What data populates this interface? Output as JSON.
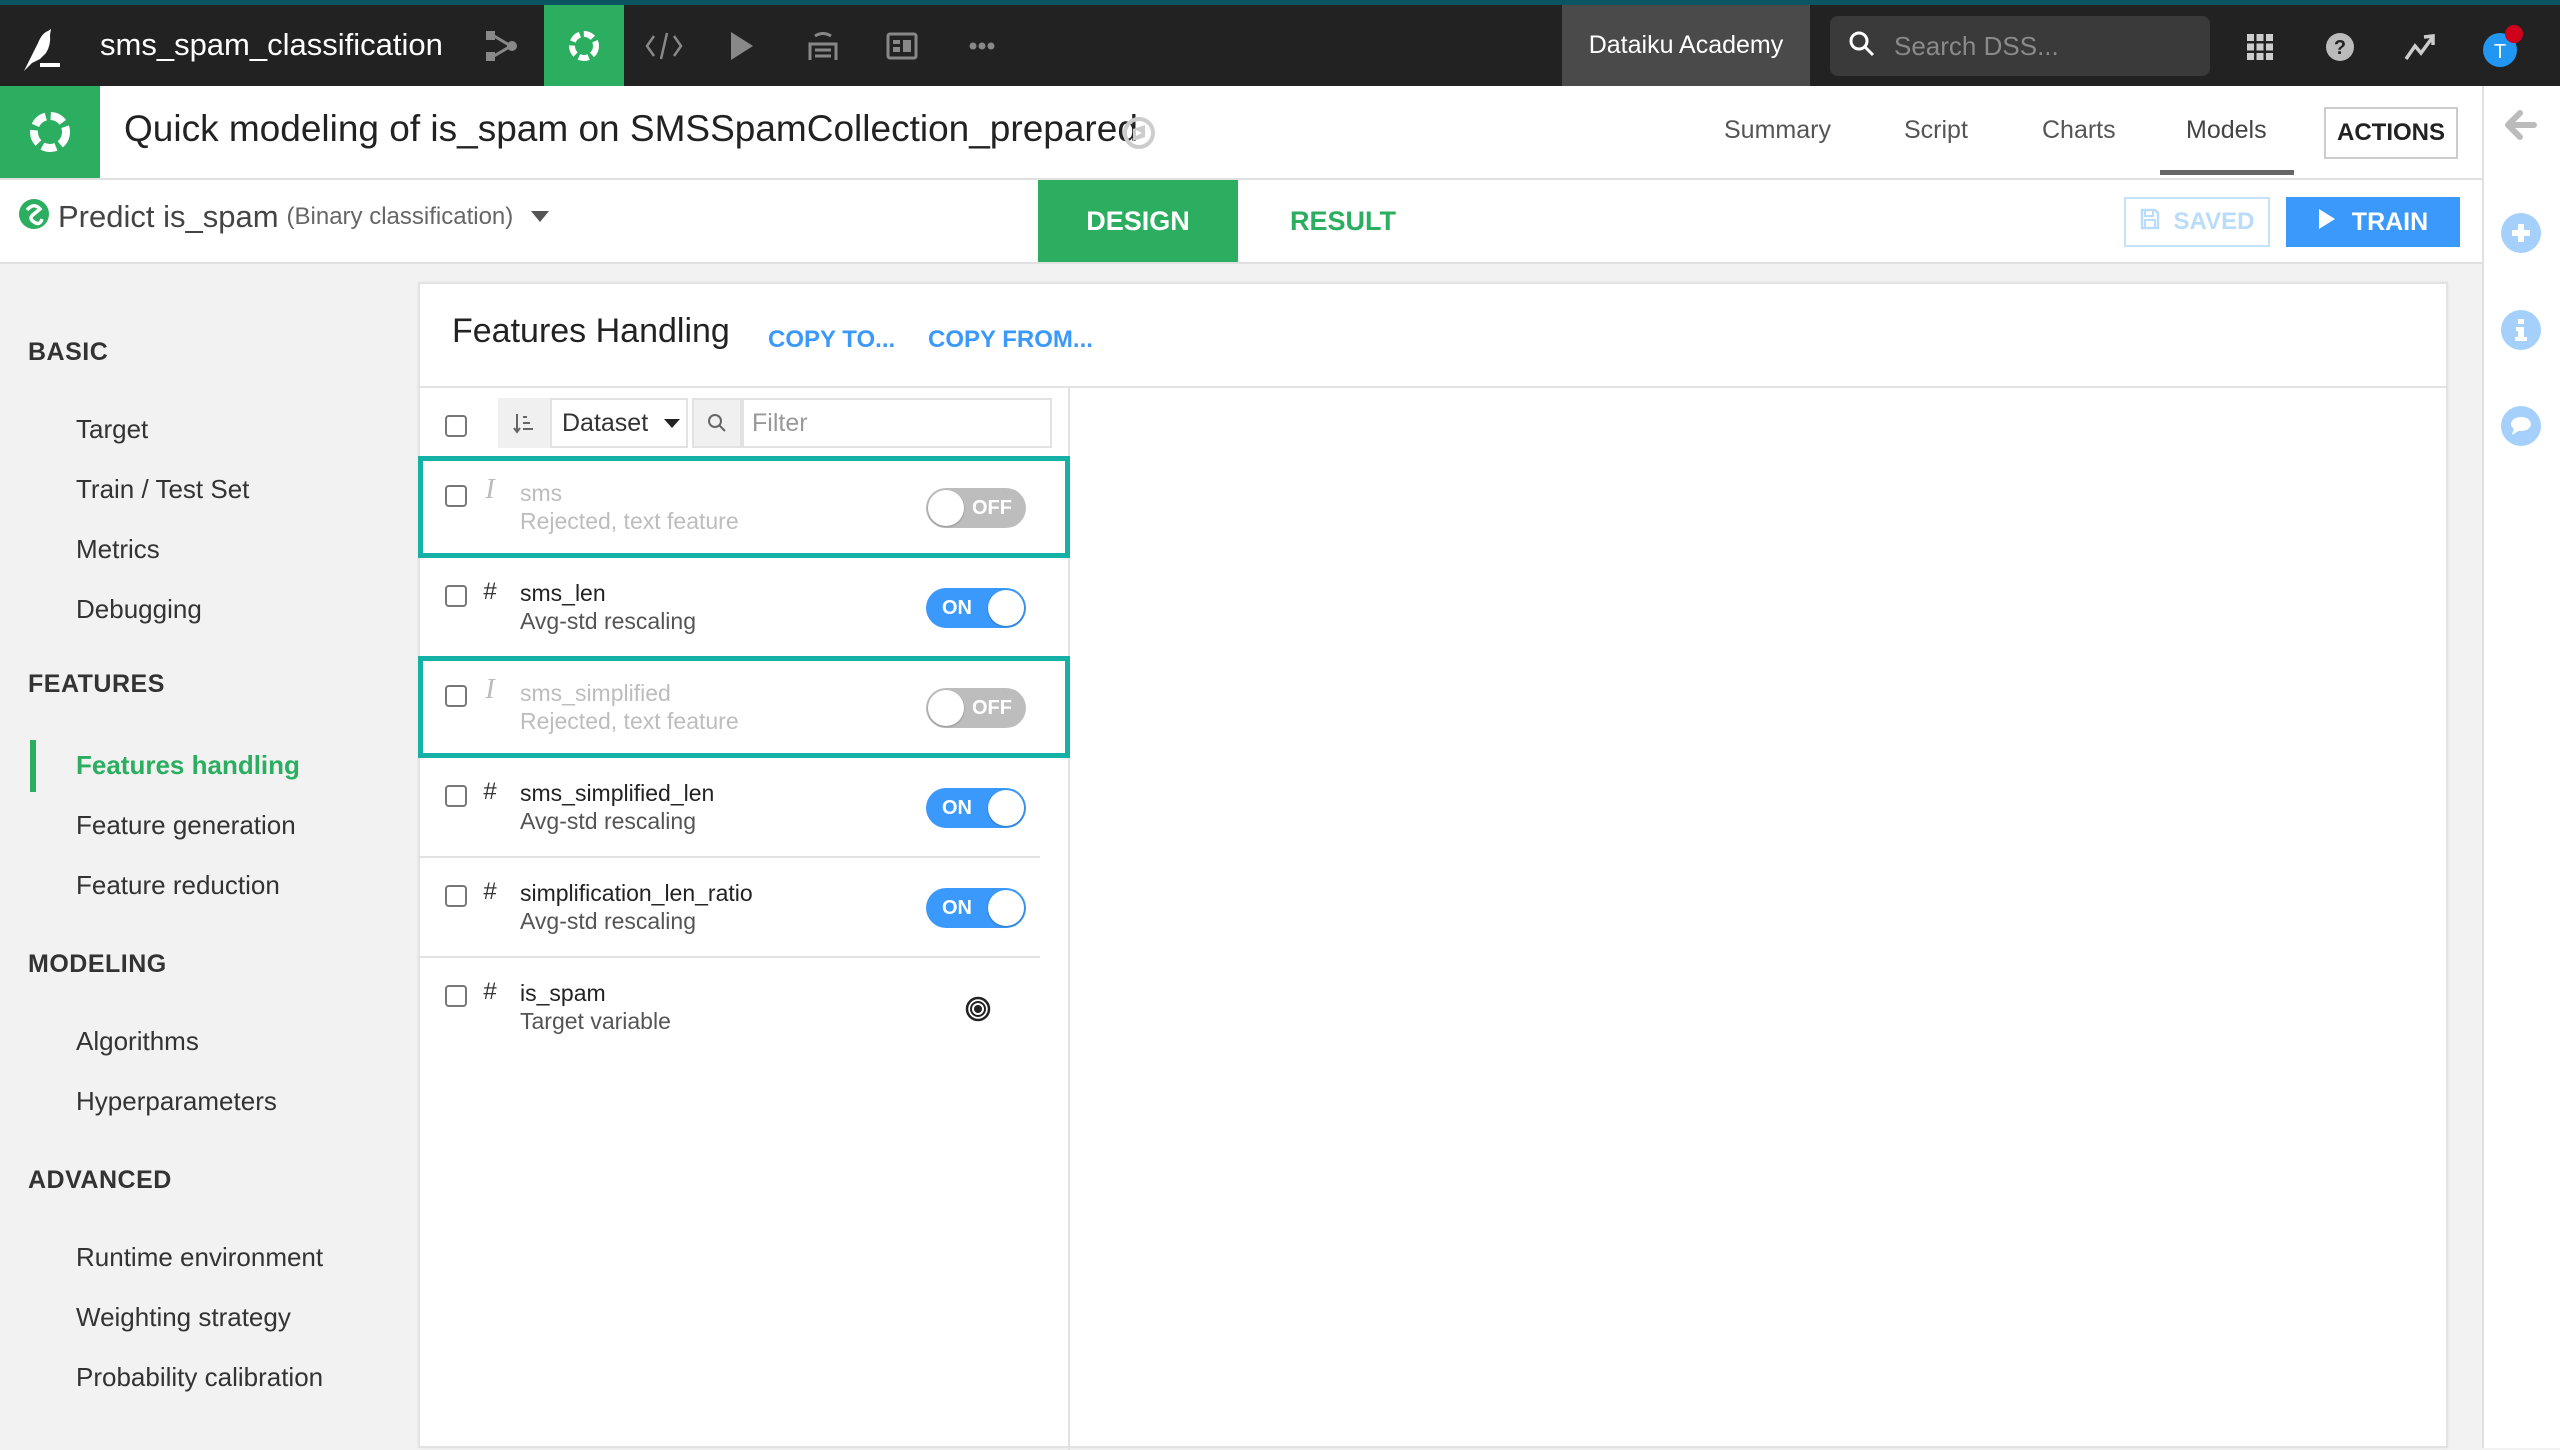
{
  "topbar": {
    "project_name": "sms_spam_classification",
    "nav_icons": [
      "flow-icon",
      "ml-icon",
      "code-icon",
      "run-icon",
      "datasets-stack-icon",
      "dashboard-icon",
      "more-icon"
    ],
    "academy_label": "Dataiku Academy",
    "search_placeholder": "Search DSS...",
    "user_initial": "T"
  },
  "titlebar": {
    "title": "Quick modeling of is_spam on SMSSpamCollection_prepared",
    "tabs": [
      {
        "label": "Summary",
        "active": false
      },
      {
        "label": "Script",
        "active": false
      },
      {
        "label": "Charts",
        "active": false
      },
      {
        "label": "Models",
        "active": true
      }
    ],
    "actions_label": "ACTIONS"
  },
  "subbar": {
    "predict_label": "Predict is_spam",
    "predict_type": "(Binary classification)",
    "tabs": [
      {
        "label": "DESIGN",
        "active": true
      },
      {
        "label": "RESULT",
        "active": false
      }
    ],
    "saved_label": "SAVED",
    "train_label": "TRAIN"
  },
  "sidebar": {
    "sections": [
      {
        "title": "BASIC",
        "items": [
          "Target",
          "Train / Test Set",
          "Metrics",
          "Debugging"
        ]
      },
      {
        "title": "FEATURES",
        "items": [
          "Features handling",
          "Feature generation",
          "Feature reduction"
        ]
      },
      {
        "title": "MODELING",
        "items": [
          "Algorithms",
          "Hyperparameters"
        ]
      },
      {
        "title": "ADVANCED",
        "items": [
          "Runtime environment",
          "Weighting strategy",
          "Probability calibration"
        ]
      }
    ],
    "active_item": "Features handling"
  },
  "panel": {
    "title": "Features Handling",
    "copy_to": "COPY TO...",
    "copy_from": "COPY FROM...",
    "sort_select": "Dataset",
    "filter_placeholder": "Filter",
    "features": [
      {
        "type": "text",
        "type_glyph": "I",
        "name": "sms",
        "desc": "Rejected, text feature",
        "state": "off",
        "toggle_label": "OFF",
        "highlighted": true
      },
      {
        "type": "numeric",
        "type_glyph": "#",
        "name": "sms_len",
        "desc": "Avg-std rescaling",
        "state": "on",
        "toggle_label": "ON",
        "highlighted": false
      },
      {
        "type": "text",
        "type_glyph": "I",
        "name": "sms_simplified",
        "desc": "Rejected, text feature",
        "state": "off",
        "toggle_label": "OFF",
        "highlighted": true
      },
      {
        "type": "numeric",
        "type_glyph": "#",
        "name": "sms_simplified_len",
        "desc": "Avg-std rescaling",
        "state": "on",
        "toggle_label": "ON",
        "highlighted": false
      },
      {
        "type": "numeric",
        "type_glyph": "#",
        "name": "simplification_len_ratio",
        "desc": "Avg-std rescaling",
        "state": "on",
        "toggle_label": "ON",
        "highlighted": false
      },
      {
        "type": "numeric",
        "type_glyph": "#",
        "name": "is_spam",
        "desc": "Target variable",
        "state": "target",
        "toggle_label": "",
        "highlighted": false
      }
    ]
  },
  "colors": {
    "brand_green": "#2bae60",
    "accent_blue": "#3b99fc",
    "highlight_teal": "#13b1a6",
    "topbar_bg": "#222222",
    "notification_red": "#d0021b"
  }
}
